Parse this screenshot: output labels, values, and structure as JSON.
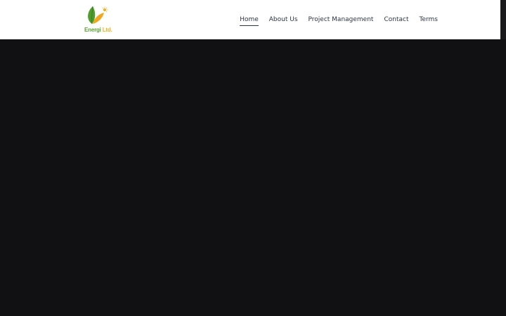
{
  "brand": {
    "name_part1": "Energi",
    "name_part2": "Ltd.",
    "colors": {
      "green": "#5aa530",
      "orange": "#f2b01e",
      "leaf_dark": "#3f8a2a"
    },
    "icon": "leaf-logo-icon"
  },
  "nav": {
    "items": [
      {
        "label": "Home",
        "active": true
      },
      {
        "label": "About Us",
        "active": false
      },
      {
        "label": "Project Management",
        "active": false
      },
      {
        "label": "Contact",
        "active": false
      },
      {
        "label": "Terms",
        "active": false
      }
    ]
  },
  "theme": {
    "header_bg": "#ffffff",
    "body_bg": "#111113",
    "nav_text": "#2b3447"
  }
}
